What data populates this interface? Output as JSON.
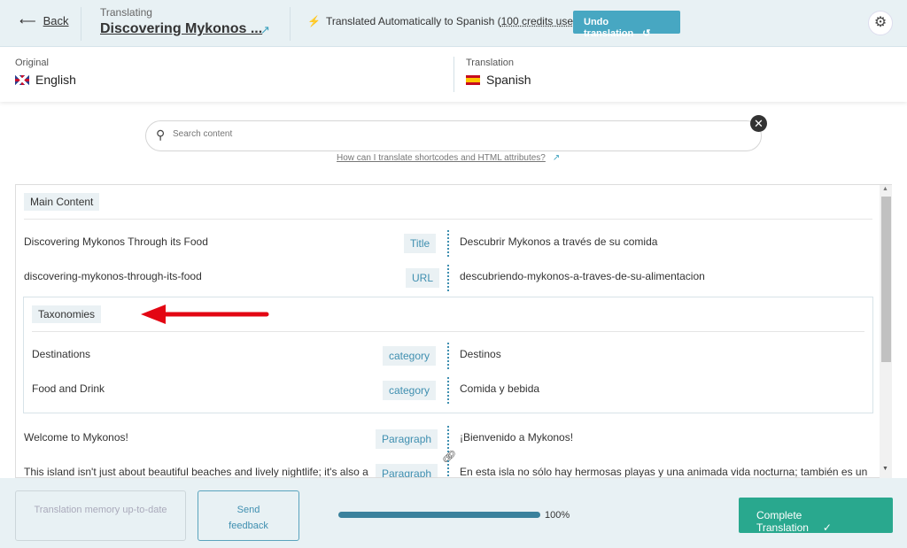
{
  "header": {
    "back_label": "Back",
    "translating_label": "Translating",
    "title": "Discovering Mykonos ...",
    "auto_text": "Translated Automatically to Spanish (",
    "credits": "100 credits used",
    "auto_close": ")",
    "undo_label": "Undo translation"
  },
  "languages": {
    "original_label": "Original",
    "original": "English",
    "translation_label": "Translation",
    "translation": "Spanish"
  },
  "search": {
    "placeholder": "Search content",
    "help_link": "How can I translate shortcodes and HTML attributes?"
  },
  "sections": {
    "main": "Main Content",
    "taxonomies": "Taxonomies"
  },
  "rows": [
    {
      "src": "Discovering Mykonos Through its Food",
      "type": "Title",
      "dst": "Descubrir Mykonos a través de su comida"
    },
    {
      "src": "discovering-mykonos-through-its-food",
      "type": "URL",
      "dst": "descubriendo-mykonos-a-traves-de-su-alimentacion"
    },
    {
      "src": "Destinations",
      "type": "category",
      "dst": "Destinos"
    },
    {
      "src": "Food and Drink",
      "type": "category",
      "dst": "Comida y bebida"
    },
    {
      "src": "Welcome to Mykonos!",
      "type": "Paragraph",
      "dst": "¡Bienvenido a Mykonos!"
    },
    {
      "src": "This island isn't just about beautiful beaches and lively nightlife; it's also a",
      "type": "Paragraph",
      "dst": "En esta isla no sólo hay hermosas playas y una animada vida nocturna; también es un"
    }
  ],
  "footer": {
    "tm_label": "Translation memory up-to-date",
    "feedback_label": "Send feedback",
    "progress_percent": 100,
    "progress_text": "100%",
    "complete_label": "Complete Translation"
  },
  "colors": {
    "accent": "#47a7c2",
    "complete": "#29a88e",
    "annotation_arrow": "#e30613"
  }
}
